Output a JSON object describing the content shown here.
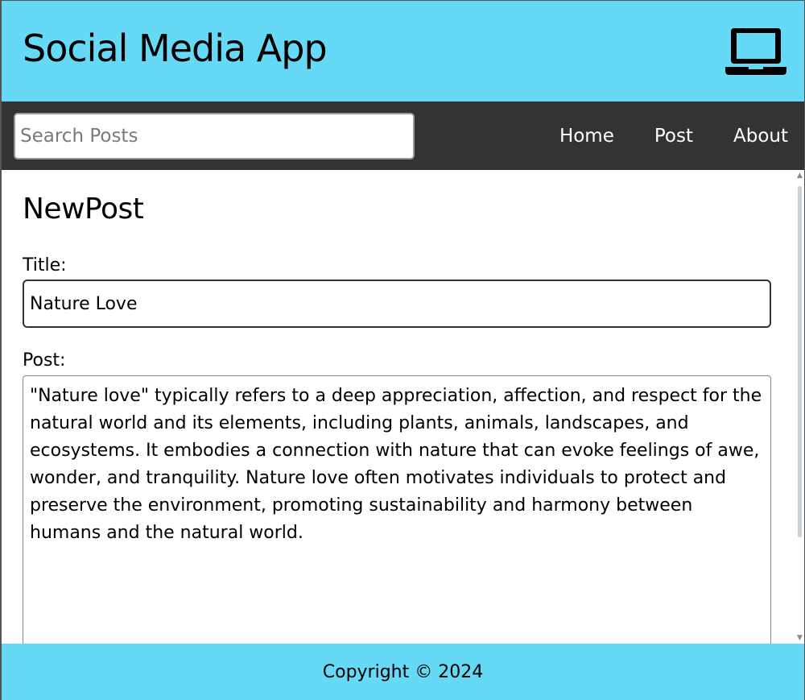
{
  "header": {
    "title": "Social Media App",
    "icon": "laptop-icon"
  },
  "nav": {
    "search_placeholder": "Search Posts",
    "search_value": "",
    "links": [
      {
        "label": "Home"
      },
      {
        "label": "Post"
      },
      {
        "label": "About"
      }
    ]
  },
  "main": {
    "page_title": "NewPost",
    "title_label": "Title:",
    "title_value": "Nature Love",
    "post_label": "Post:",
    "post_value": "\"Nature love\" typically refers to a deep appreciation, affection, and respect for the natural world and its elements, including plants, animals, landscapes, and ecosystems. It embodies a connection with nature that can evoke feelings of awe, wonder, and tranquility. Nature love often motivates individuals to protect and preserve the environment, promoting sustainability and harmony between humans and the natural world."
  },
  "footer": {
    "copyright": "Copyright © 2024"
  },
  "colors": {
    "header_bg": "#66d9f6",
    "nav_bg": "#333333",
    "footer_bg": "#66d9f6"
  }
}
